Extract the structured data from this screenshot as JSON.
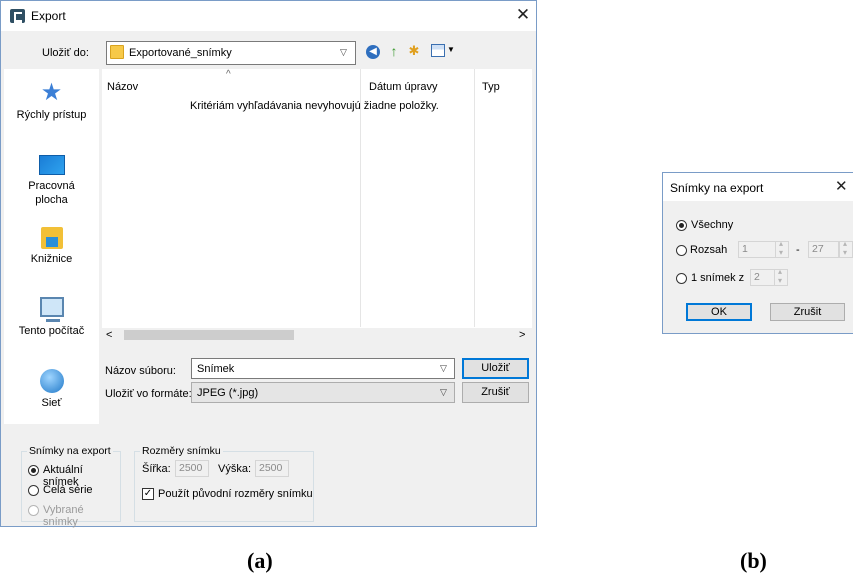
{
  "export_dialog": {
    "title": "Export",
    "save_in_label": "Uložiť do:",
    "save_in_value": "Exportované_snímky",
    "places": [
      {
        "label": "Rýchly prístup",
        "icon": "star-icon"
      },
      {
        "label": "Pracovná plocha",
        "icon": "desktop-icon"
      },
      {
        "label": "Knižnice",
        "icon": "library-icon"
      },
      {
        "label": "Tento počítač",
        "icon": "computer-icon"
      },
      {
        "label": "Sieť",
        "icon": "network-icon"
      }
    ],
    "columns": [
      "Názov",
      "Dátum úpravy",
      "Typ"
    ],
    "empty_message": "Kritériám vyhľadávania nevyhovujú žiadne položky.",
    "filename_label": "Názov súboru:",
    "filename_value": "Snímek",
    "format_label": "Uložiť vo formáte:",
    "format_value": "JPEG (*.jpg)",
    "save_button": "Uložiť",
    "cancel_button": "Zrušiť",
    "snimky_group": {
      "title": "Snímky na export",
      "options": [
        "Aktuální snímek",
        "Celá série",
        "Vybrané snímky"
      ],
      "selected": "Aktuální snímek"
    },
    "rozmery_group": {
      "title": "Rozměry snímku",
      "width_label": "Šířka:",
      "width_value": "2500",
      "height_label": "Výška:",
      "height_value": "2500",
      "checkbox_label": "Použít původní rozměry snímku",
      "checkbox_checked": true
    }
  },
  "range_dialog": {
    "title": "Snímky na export",
    "option_all": "Všechny",
    "option_range": "Rozsah",
    "range_from": "1",
    "range_dash": "-",
    "range_to": "27",
    "option_single": "1 snímek z",
    "single_value": "2",
    "selected": "Všechny",
    "ok_button": "OK",
    "cancel_button": "Zrušit"
  },
  "captions": {
    "a": "(a)",
    "b": "(b)"
  }
}
